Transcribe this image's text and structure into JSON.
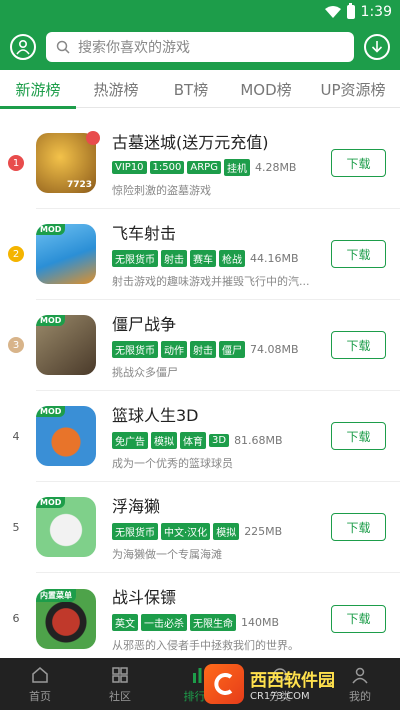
{
  "status": {
    "time": "1:39"
  },
  "search": {
    "placeholder": "搜索你喜欢的游戏"
  },
  "tabs": [
    {
      "label": "新游榜"
    },
    {
      "label": "热游榜"
    },
    {
      "label": "BT榜"
    },
    {
      "label": "MOD榜"
    },
    {
      "label": "UP资源榜"
    }
  ],
  "games": [
    {
      "rank": "1",
      "title": "古墓迷城(送万元充值)",
      "tags": [
        "VIP10",
        "1:500",
        "ARPG",
        "挂机"
      ],
      "size": "4.28MB",
      "desc": "惊险刺激的盗墓游戏",
      "button": "下载",
      "mod": "",
      "icon_text": "7723",
      "icon_color": "#8b5a1a"
    },
    {
      "rank": "2",
      "title": "飞车射击",
      "tags": [
        "无限货币",
        "射击",
        "赛车",
        "枪战"
      ],
      "size": "44.16MB",
      "desc": "射击游戏的趣味游戏并摧毁飞行中的汽...",
      "button": "下载",
      "mod": "MOD",
      "icon_text": "",
      "icon_color": "#2b8fd6"
    },
    {
      "rank": "3",
      "title": "僵尸战争",
      "tags": [
        "无限货币",
        "动作",
        "射击",
        "僵尸"
      ],
      "size": "74.08MB",
      "desc": "挑战众多僵尸",
      "button": "下载",
      "mod": "MOD",
      "icon_text": "",
      "icon_color": "#5a4a3a"
    },
    {
      "rank": "4",
      "title": "篮球人生3D",
      "tags": [
        "免广告",
        "模拟",
        "体育",
        "3D"
      ],
      "size": "81.68MB",
      "desc": "成为一个优秀的篮球球员",
      "button": "下载",
      "mod": "MOD",
      "icon_text": "",
      "icon_color": "#3a8fd6"
    },
    {
      "rank": "5",
      "title": "浮海獭",
      "tags": [
        "无限货币",
        "中文·汉化",
        "模拟"
      ],
      "size": "225MB",
      "desc": "为海獭做一个专属海滩",
      "button": "下载",
      "mod": "MOD",
      "icon_text": "",
      "icon_color": "#7fd08a"
    },
    {
      "rank": "6",
      "title": "战斗保镖",
      "tags": [
        "英文",
        "一击必杀",
        "无限生命"
      ],
      "size": "140MB",
      "desc": "从邪恶的入侵者手中拯救我们的世界。",
      "button": "下载",
      "mod": "内置菜单",
      "icon_text": "",
      "icon_color": "#4ea34a"
    }
  ],
  "bottom_nav": [
    {
      "label": "首页"
    },
    {
      "label": "社区"
    },
    {
      "label": "排行榜"
    },
    {
      "label": "分类"
    },
    {
      "label": "我的"
    }
  ],
  "watermark": {
    "brand": "西西软件园",
    "url": "CR173.COM"
  },
  "colors": {
    "primary": "#1d9d4a",
    "rank1": "#e84c4c",
    "rank2": "#f4b400",
    "rank3": "#d8b48a"
  }
}
